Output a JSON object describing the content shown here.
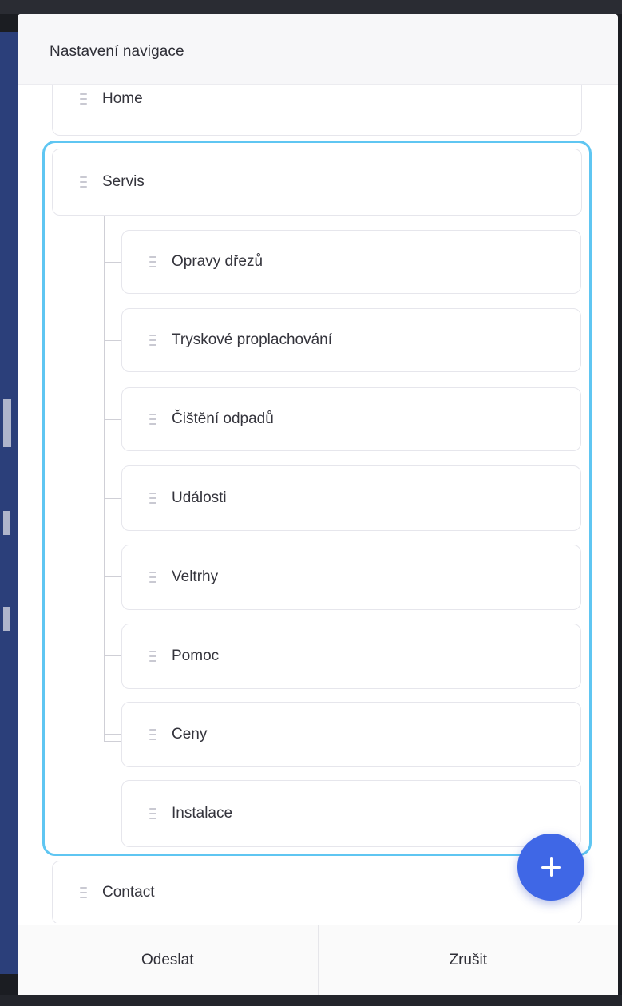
{
  "dialog": {
    "title": "Nastavení navigace"
  },
  "navigation": {
    "items": [
      {
        "label": "Home"
      },
      {
        "label": "Servis",
        "children": [
          {
            "label": "Opravy dřezů"
          },
          {
            "label": "Tryskové proplachování"
          },
          {
            "label": "Čištění odpadů"
          },
          {
            "label": "Události"
          },
          {
            "label": "Veltrhy"
          },
          {
            "label": "Pomoc"
          },
          {
            "label": "Ceny"
          },
          {
            "label": "Instalace"
          }
        ]
      },
      {
        "label": "Contact"
      }
    ]
  },
  "actions": {
    "add_icon": "plus-icon",
    "submit_label": "Odeslat",
    "cancel_label": "Zrušit"
  },
  "colors": {
    "accent": "#3f67e6",
    "group_outline": "#5fc6f2"
  }
}
